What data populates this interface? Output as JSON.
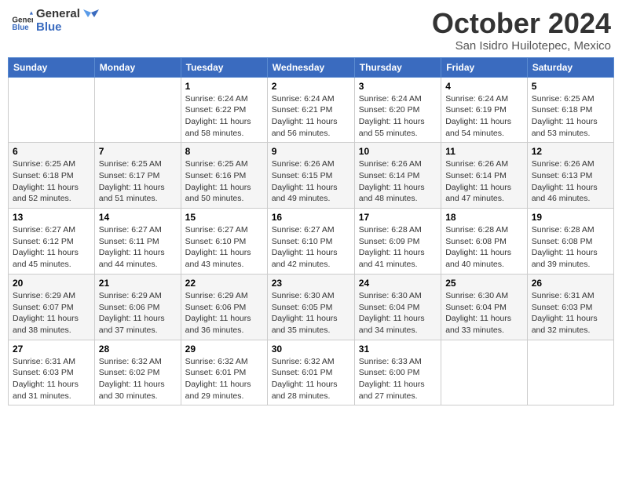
{
  "header": {
    "logo_line1": "General",
    "logo_line2": "Blue",
    "month": "October 2024",
    "location": "San Isidro Huilotepec, Mexico"
  },
  "weekdays": [
    "Sunday",
    "Monday",
    "Tuesday",
    "Wednesday",
    "Thursday",
    "Friday",
    "Saturday"
  ],
  "weeks": [
    [
      {
        "day": "",
        "info": ""
      },
      {
        "day": "",
        "info": ""
      },
      {
        "day": "1",
        "info": "Sunrise: 6:24 AM\nSunset: 6:22 PM\nDaylight: 11 hours and 58 minutes."
      },
      {
        "day": "2",
        "info": "Sunrise: 6:24 AM\nSunset: 6:21 PM\nDaylight: 11 hours and 56 minutes."
      },
      {
        "day": "3",
        "info": "Sunrise: 6:24 AM\nSunset: 6:20 PM\nDaylight: 11 hours and 55 minutes."
      },
      {
        "day": "4",
        "info": "Sunrise: 6:24 AM\nSunset: 6:19 PM\nDaylight: 11 hours and 54 minutes."
      },
      {
        "day": "5",
        "info": "Sunrise: 6:25 AM\nSunset: 6:18 PM\nDaylight: 11 hours and 53 minutes."
      }
    ],
    [
      {
        "day": "6",
        "info": "Sunrise: 6:25 AM\nSunset: 6:18 PM\nDaylight: 11 hours and 52 minutes."
      },
      {
        "day": "7",
        "info": "Sunrise: 6:25 AM\nSunset: 6:17 PM\nDaylight: 11 hours and 51 minutes."
      },
      {
        "day": "8",
        "info": "Sunrise: 6:25 AM\nSunset: 6:16 PM\nDaylight: 11 hours and 50 minutes."
      },
      {
        "day": "9",
        "info": "Sunrise: 6:26 AM\nSunset: 6:15 PM\nDaylight: 11 hours and 49 minutes."
      },
      {
        "day": "10",
        "info": "Sunrise: 6:26 AM\nSunset: 6:14 PM\nDaylight: 11 hours and 48 minutes."
      },
      {
        "day": "11",
        "info": "Sunrise: 6:26 AM\nSunset: 6:14 PM\nDaylight: 11 hours and 47 minutes."
      },
      {
        "day": "12",
        "info": "Sunrise: 6:26 AM\nSunset: 6:13 PM\nDaylight: 11 hours and 46 minutes."
      }
    ],
    [
      {
        "day": "13",
        "info": "Sunrise: 6:27 AM\nSunset: 6:12 PM\nDaylight: 11 hours and 45 minutes."
      },
      {
        "day": "14",
        "info": "Sunrise: 6:27 AM\nSunset: 6:11 PM\nDaylight: 11 hours and 44 minutes."
      },
      {
        "day": "15",
        "info": "Sunrise: 6:27 AM\nSunset: 6:10 PM\nDaylight: 11 hours and 43 minutes."
      },
      {
        "day": "16",
        "info": "Sunrise: 6:27 AM\nSunset: 6:10 PM\nDaylight: 11 hours and 42 minutes."
      },
      {
        "day": "17",
        "info": "Sunrise: 6:28 AM\nSunset: 6:09 PM\nDaylight: 11 hours and 41 minutes."
      },
      {
        "day": "18",
        "info": "Sunrise: 6:28 AM\nSunset: 6:08 PM\nDaylight: 11 hours and 40 minutes."
      },
      {
        "day": "19",
        "info": "Sunrise: 6:28 AM\nSunset: 6:08 PM\nDaylight: 11 hours and 39 minutes."
      }
    ],
    [
      {
        "day": "20",
        "info": "Sunrise: 6:29 AM\nSunset: 6:07 PM\nDaylight: 11 hours and 38 minutes."
      },
      {
        "day": "21",
        "info": "Sunrise: 6:29 AM\nSunset: 6:06 PM\nDaylight: 11 hours and 37 minutes."
      },
      {
        "day": "22",
        "info": "Sunrise: 6:29 AM\nSunset: 6:06 PM\nDaylight: 11 hours and 36 minutes."
      },
      {
        "day": "23",
        "info": "Sunrise: 6:30 AM\nSunset: 6:05 PM\nDaylight: 11 hours and 35 minutes."
      },
      {
        "day": "24",
        "info": "Sunrise: 6:30 AM\nSunset: 6:04 PM\nDaylight: 11 hours and 34 minutes."
      },
      {
        "day": "25",
        "info": "Sunrise: 6:30 AM\nSunset: 6:04 PM\nDaylight: 11 hours and 33 minutes."
      },
      {
        "day": "26",
        "info": "Sunrise: 6:31 AM\nSunset: 6:03 PM\nDaylight: 11 hours and 32 minutes."
      }
    ],
    [
      {
        "day": "27",
        "info": "Sunrise: 6:31 AM\nSunset: 6:03 PM\nDaylight: 11 hours and 31 minutes."
      },
      {
        "day": "28",
        "info": "Sunrise: 6:32 AM\nSunset: 6:02 PM\nDaylight: 11 hours and 30 minutes."
      },
      {
        "day": "29",
        "info": "Sunrise: 6:32 AM\nSunset: 6:01 PM\nDaylight: 11 hours and 29 minutes."
      },
      {
        "day": "30",
        "info": "Sunrise: 6:32 AM\nSunset: 6:01 PM\nDaylight: 11 hours and 28 minutes."
      },
      {
        "day": "31",
        "info": "Sunrise: 6:33 AM\nSunset: 6:00 PM\nDaylight: 11 hours and 27 minutes."
      },
      {
        "day": "",
        "info": ""
      },
      {
        "day": "",
        "info": ""
      }
    ]
  ]
}
